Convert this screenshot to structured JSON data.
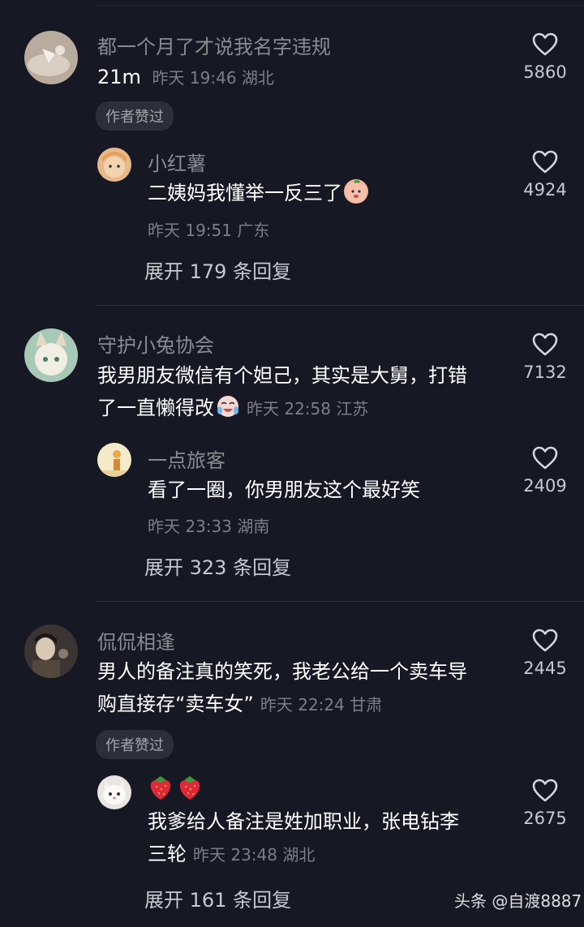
{
  "comments": [
    {
      "username": "都一个月了才说我名字违规",
      "text_line1": "21m",
      "meta": "昨天 19:46 湖北",
      "likes": "5860",
      "badge": "作者赞过",
      "reply": {
        "username": "小红薯",
        "text_line1": "二姨妈我懂举一反三了",
        "emoji": "peach-face-emoji",
        "meta": "昨天 19:51 广东",
        "likes": "4924"
      },
      "expand": "展开 179 条回复"
    },
    {
      "username": "守护小兔协会",
      "text_line1": "我男朋友微信有个妲己，其实是大舅，打错",
      "text_line2": "了一直懒得改",
      "emoji": "crying-laugh-emoji",
      "meta": "昨天 22:58 江苏",
      "likes": "7132",
      "reply": {
        "username": "一点旅客",
        "text_line1": "看了一圈，你男朋友这个最好笑",
        "meta": "昨天 23:33 湖南",
        "likes": "2409"
      },
      "expand": "展开 323 条回复"
    },
    {
      "username": "侃侃相逢",
      "text_line1": "男人的备注真的笑死，我老公给一个卖车导",
      "text_line2": "购直接存“卖车女”",
      "meta": "昨天 22:24 甘肃",
      "likes": "2445",
      "badge": "作者赞过",
      "reply": {
        "username_emoji": "strawberry-emoji",
        "text_line1": "我爹给人备注是姓加职业，张电钻李",
        "text_line2": "三轮",
        "meta": "昨天 23:48 湖北",
        "likes": "2675"
      },
      "expand": "展开 161 条回复"
    }
  ],
  "watermark": "头条 @自渡8887"
}
